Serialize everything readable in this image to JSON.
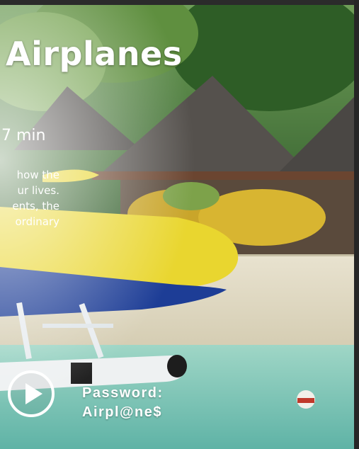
{
  "slide": {
    "title": "Airplanes",
    "duration": "7 min",
    "description_lines": [
      "how the",
      "ur lives.",
      "ents, the",
      "ordinary"
    ],
    "password_label": "Password:",
    "password_value": "Airpl@ne$"
  },
  "icons": {
    "play": "play-icon"
  },
  "colors": {
    "text": "#ffffff",
    "frame_border": "#2b2b2b"
  }
}
